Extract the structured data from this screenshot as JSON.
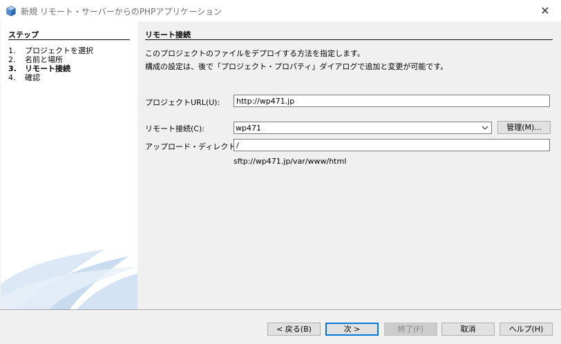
{
  "window": {
    "title": "新規 リモート・サーバーからのPHPアプリケーション",
    "icons": {
      "app": "netbeans-cube-icon",
      "close": "close-icon"
    },
    "close_label": "✕"
  },
  "steps": {
    "title": "ステップ",
    "items": [
      {
        "num": "1.",
        "label": "プロジェクトを選択"
      },
      {
        "num": "2.",
        "label": "名前と場所"
      },
      {
        "num": "3.",
        "label": "リモート接続"
      },
      {
        "num": "4.",
        "label": "確認"
      }
    ],
    "current_index": 2
  },
  "panel": {
    "title": "リモート接続",
    "description": [
      "このプロジェクトのファイルをデプロイする方法を指定します。",
      "構成の設定は、後で「プロジェクト・プロパティ」ダイアログで追加と変更が可能です。"
    ],
    "project_url": {
      "label": "プロジェクトURL(U):",
      "value": "http://wp471.jp"
    },
    "remote_connection": {
      "label": "リモート接続(C):",
      "value": "wp471",
      "manage_label": "管理(M)..."
    },
    "upload_dir": {
      "label": "アップロード・ディレクトリ(L):",
      "value": "/",
      "hint": "sftp://wp471.jp/var/www/html"
    }
  },
  "buttons": {
    "back": "< 戻る(B)",
    "next": "次 >",
    "finish": "終了(F)",
    "cancel": "取消",
    "help": "ヘルプ(H)"
  },
  "colors": {
    "accent": "#0078d7",
    "swoosh": "#c9dcef"
  }
}
